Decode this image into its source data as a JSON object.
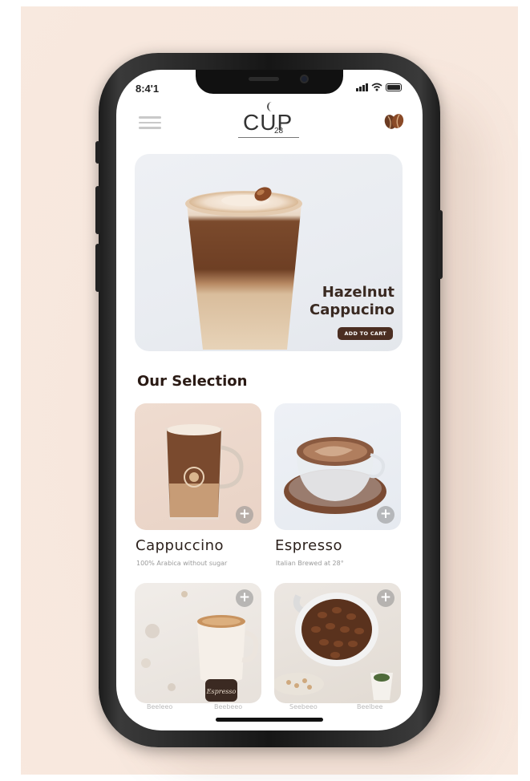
{
  "status_bar": {
    "time": "8:4'1"
  },
  "header": {
    "logo_text": "CUP",
    "logo_number": "28"
  },
  "hero": {
    "title_line1": "Hazelnut",
    "title_line2": "Cappucino",
    "cta_label": "ADD TO CART"
  },
  "selection": {
    "title": "Our Selection",
    "items": [
      {
        "name": "Cappuccino",
        "description": "100% Arabica without sugar"
      },
      {
        "name": "Espresso",
        "description": "Italian Brewed at 28°"
      },
      {
        "cup_label": "Espresso"
      }
    ]
  },
  "bottom_nav": {
    "labels": [
      "Beeleeo",
      "Beebeeo",
      "Seebeeo",
      "Beelbee"
    ]
  },
  "colors": {
    "background": "#f7e7dd",
    "accent_brown": "#4b2e22",
    "title_text": "#3a2a22"
  }
}
